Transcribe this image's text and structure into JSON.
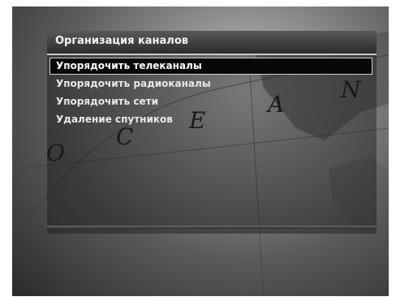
{
  "screen": {
    "title": "Организация каналов",
    "menu_items": [
      {
        "label": "Упорядочить телеканалы",
        "selected": true
      },
      {
        "label": "Упорядочить радиоканалы",
        "selected": false
      },
      {
        "label": "Упорядочить сети",
        "selected": false
      },
      {
        "label": "Удаление спутников",
        "selected": false
      }
    ],
    "background_map_letters": [
      "O",
      "C",
      "E",
      "A",
      "N"
    ]
  },
  "colors": {
    "selection_background": "#080808",
    "selection_border": "#d0d0d0",
    "text": "#e8e8e8"
  }
}
